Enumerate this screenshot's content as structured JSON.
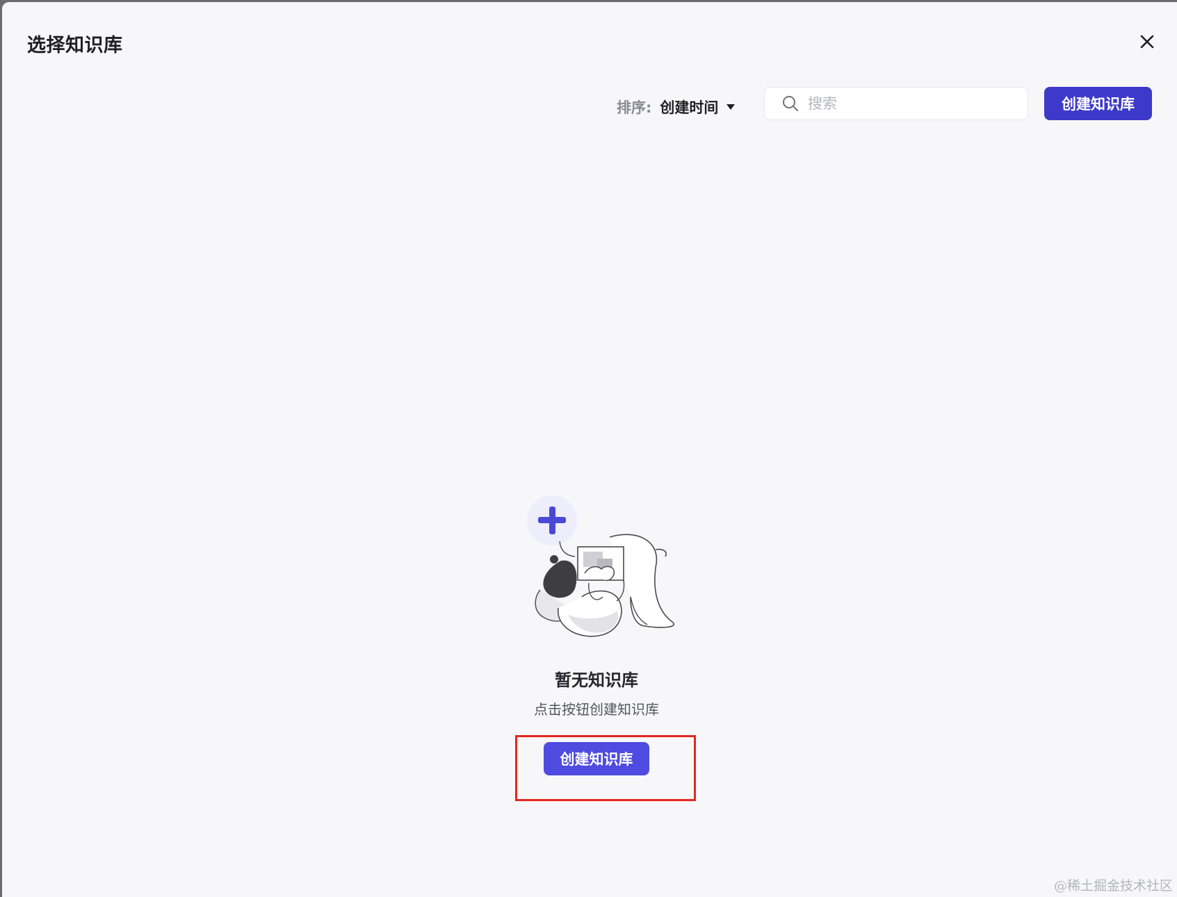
{
  "modal": {
    "title": "选择知识库",
    "close_icon": "close-icon"
  },
  "toolbar": {
    "sort_label": "排序:",
    "sort_value": "创建时间",
    "sort_caret_icon": "caret-down-icon",
    "search_placeholder": "搜索",
    "search_value": "",
    "search_icon": "search-icon",
    "create_button_label": "创建知识库"
  },
  "empty_state": {
    "illustration_icon": "empty-knowledge-base-illustration",
    "title": "暂无知识库",
    "subtitle": "点击按钮创建知识库",
    "create_button_label": "创建知识库"
  },
  "watermark": "@稀土掘金技术社区",
  "colors": {
    "primary": "#4b48d6",
    "primary_header": "#3d39c9",
    "highlight": "#e5261f",
    "background": "#f7f7f9"
  }
}
